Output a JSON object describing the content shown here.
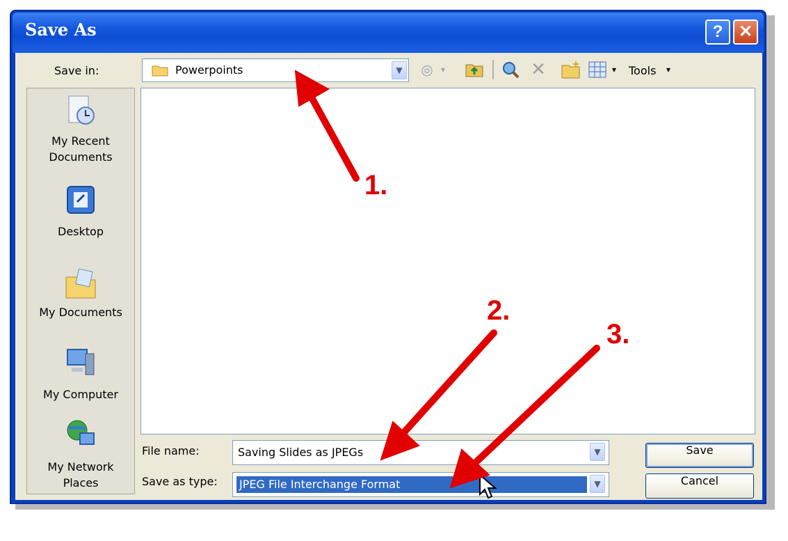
{
  "window": {
    "title": "Save As",
    "help_glyph": "?",
    "close_glyph": "✕"
  },
  "toolbar": {
    "save_in_label": "Save in:",
    "save_in_value": "Powerpoints",
    "tools_label": "Tools",
    "icons": [
      "back-icon",
      "up-folder-icon",
      "search-web-icon",
      "delete-icon",
      "new-folder-icon",
      "views-icon"
    ]
  },
  "places": [
    {
      "label": "My Recent Documents",
      "line1": "My Recent",
      "line2": "Documents",
      "icon": "recent-documents-icon"
    },
    {
      "label": "Desktop",
      "line1": "Desktop",
      "line2": "",
      "icon": "desktop-icon"
    },
    {
      "label": "My Documents",
      "line1": "My Documents",
      "line2": "",
      "icon": "my-documents-icon"
    },
    {
      "label": "My Computer",
      "line1": "My Computer",
      "line2": "",
      "icon": "my-computer-icon"
    },
    {
      "label": "My Network Places",
      "line1": "My Network",
      "line2": "Places",
      "icon": "network-places-icon"
    }
  ],
  "form": {
    "file_name_label": "File name:",
    "file_name_value": "Saving Slides as JPEGs",
    "save_as_type_label": "Save as type:",
    "save_as_type_value": "JPEG File Interchange Format"
  },
  "buttons": {
    "save": "Save",
    "cancel": "Cancel"
  },
  "annotations": [
    "1.",
    "2.",
    "3."
  ],
  "colors": {
    "title_bar": "#0e4ed6",
    "dialog_bg": "#ece9d8",
    "selection": "#316ac5",
    "annotation_red": "#e00000"
  }
}
